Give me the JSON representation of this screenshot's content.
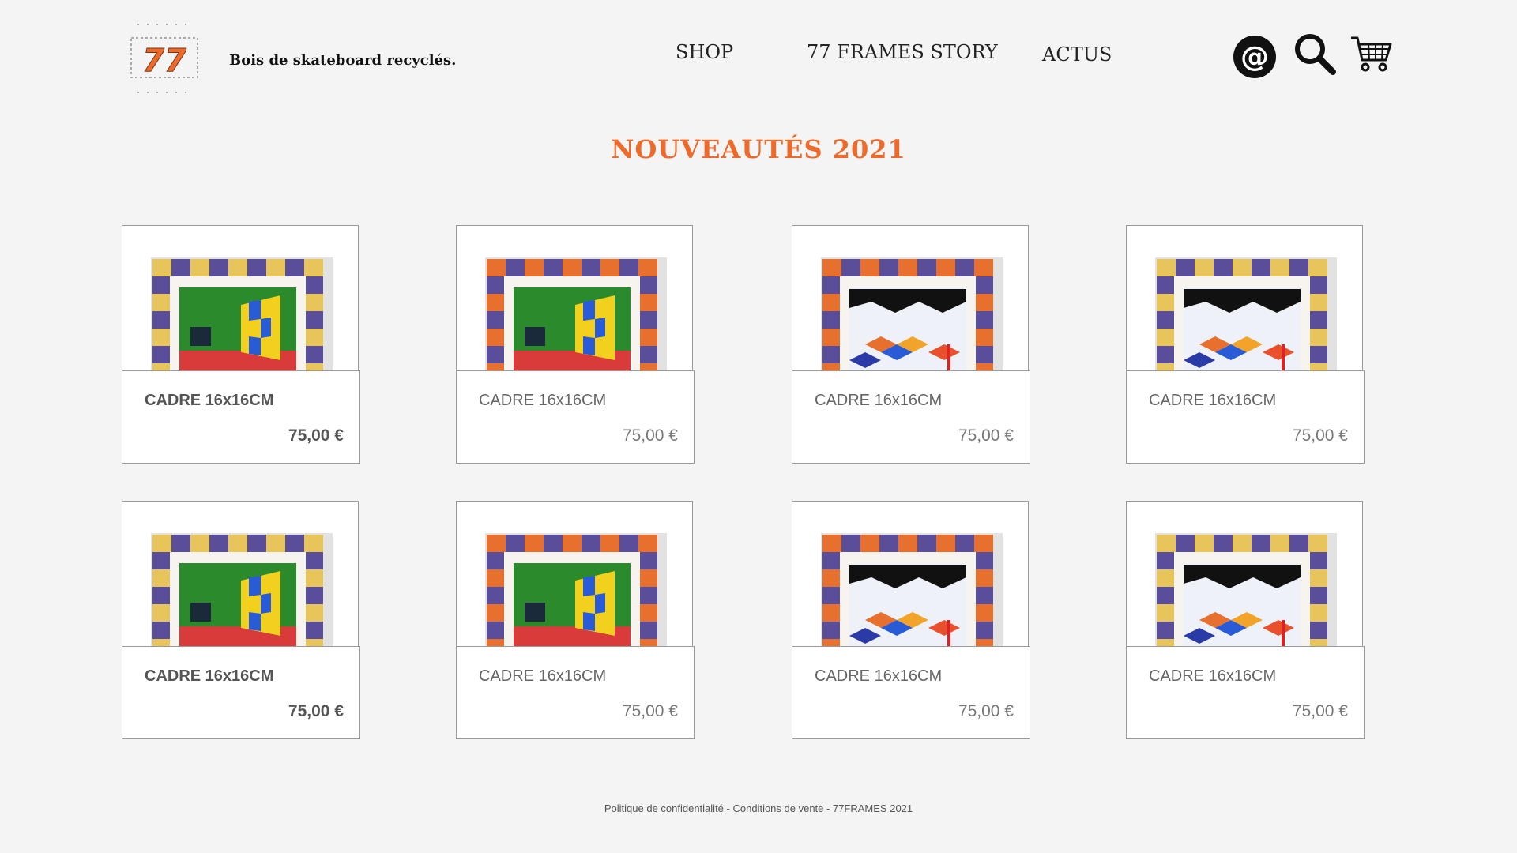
{
  "brand": {
    "logo_text": "77",
    "tagline": "Bois de skateboard recyclés.",
    "accent": "#ee6a2b"
  },
  "nav": [
    {
      "label": "SHOP"
    },
    {
      "label": "77 FRAMES STORY"
    },
    {
      "label": "ACTUS"
    }
  ],
  "icons": [
    "at-icon",
    "search-icon",
    "cart-icon"
  ],
  "section": {
    "title": "NOUVEAUTÉS 2021"
  },
  "products": [
    {
      "name": "CADRE 16x16CM",
      "price": "75,00 €",
      "art": "green-room",
      "frame": "yellow-purple"
    },
    {
      "name": "CADRE 16x16CM",
      "price": "75,00 €",
      "art": "green-room",
      "frame": "orange-purple"
    },
    {
      "name": "CADRE 16x16CM",
      "price": "75,00 €",
      "art": "mountains",
      "frame": "orange-purple"
    },
    {
      "name": "CADRE 16x16CM",
      "price": "75,00 €",
      "art": "mountains",
      "frame": "yellow-purple"
    },
    {
      "name": "CADRE 16x16CM",
      "price": "75,00 €",
      "art": "green-room",
      "frame": "yellow-purple"
    },
    {
      "name": "CADRE 16x16CM",
      "price": "75,00 €",
      "art": "green-room",
      "frame": "orange-purple"
    },
    {
      "name": "CADRE 16x16CM",
      "price": "75,00 €",
      "art": "mountains",
      "frame": "orange-purple"
    },
    {
      "name": "CADRE 16x16CM",
      "price": "75,00 €",
      "art": "mountains",
      "frame": "yellow-purple"
    }
  ],
  "footer": {
    "privacy": "Politique de confidentialité",
    "terms": "Conditions de vente",
    "copyright": "77FRAMES 2021",
    "separator": " - "
  }
}
